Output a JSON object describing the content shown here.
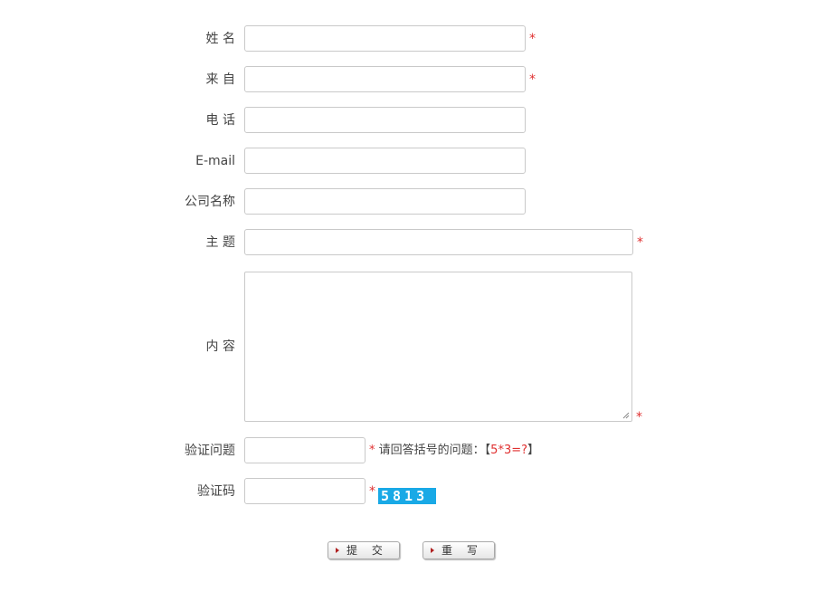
{
  "form": {
    "name_label": "姓  名",
    "from_label": "来  自",
    "phone_label": "电  话",
    "email_label": "E-mail",
    "company_label": "公司名称",
    "subject_label": "主  题",
    "content_label": "内  容",
    "question_label": "验证问题",
    "captcha_label": "验证码",
    "required_mark": "*",
    "question_hint": "请回答括号的问题：",
    "question_open": "【",
    "question_text": "5*3=?",
    "question_close": "】",
    "captcha_value": "5813"
  },
  "buttons": {
    "submit": "提 交",
    "reset": "重 写"
  },
  "colors": {
    "required": "#e03030",
    "captcha_bg": "#19a9e6",
    "border": "#c9c9c9"
  }
}
